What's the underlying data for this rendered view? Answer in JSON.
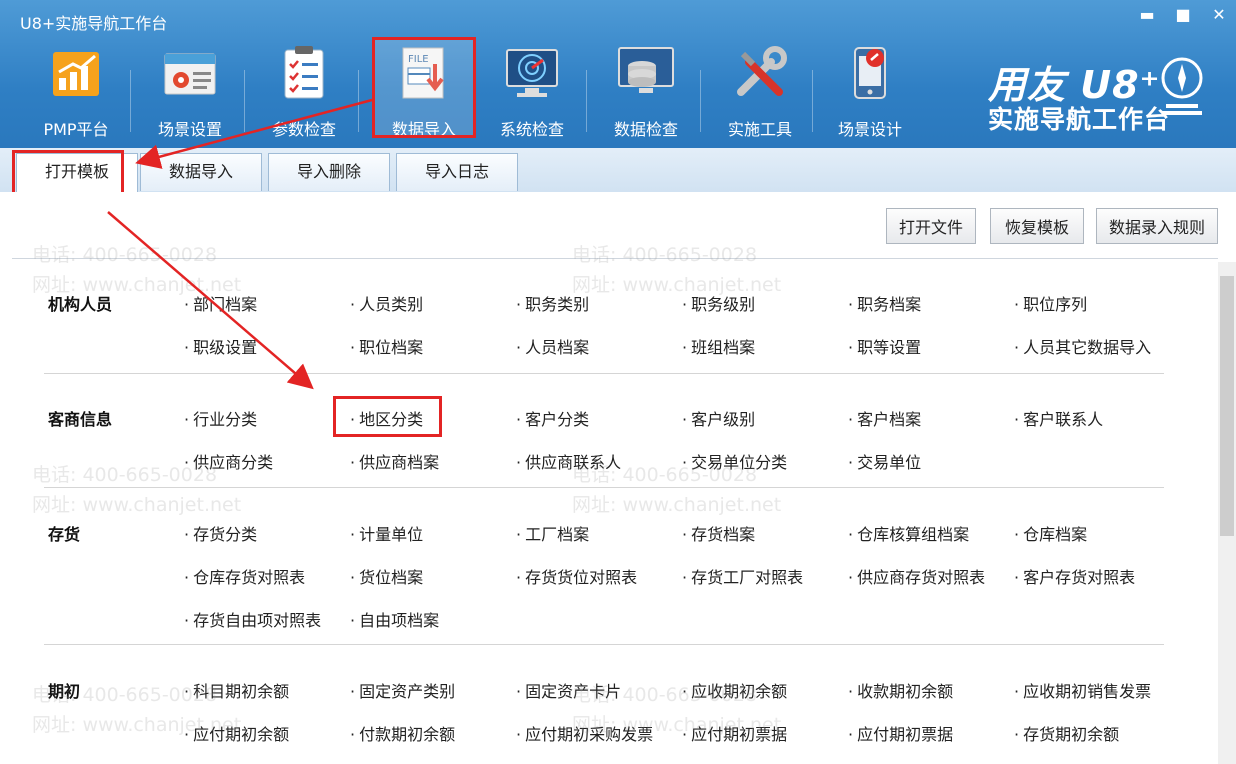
{
  "window": {
    "title": "U8+实施导航工作台",
    "min": "▬",
    "max": "■",
    "close": "✕"
  },
  "toolbar": [
    {
      "label": "PMP平台",
      "icon": "chart-bars-icon"
    },
    {
      "label": "场景设置",
      "icon": "gear-screen-icon"
    },
    {
      "label": "参数检查",
      "icon": "clipboard-check-icon"
    },
    {
      "label": "数据导入",
      "icon": "file-import-icon"
    },
    {
      "label": "系统检查",
      "icon": "monitor-radar-icon"
    },
    {
      "label": "数据检查",
      "icon": "database-check-icon"
    },
    {
      "label": "实施工具",
      "icon": "tools-icon"
    },
    {
      "label": "场景设计",
      "icon": "phone-design-icon"
    }
  ],
  "logo": {
    "line1": "用友 U8⁺",
    "line2": "实施导航工作台"
  },
  "tabs": [
    "打开模板",
    "数据导入",
    "导入删除",
    "导入日志"
  ],
  "buttons": {
    "open_file": "打开文件",
    "restore_template": "恢复模板",
    "entry_rules": "数据录入规则"
  },
  "sections": [
    {
      "title": "机构人员",
      "rows": [
        [
          "部门档案",
          "人员类别",
          "职务类别",
          "职务级别",
          "职务档案",
          "职位序列"
        ],
        [
          "职级设置",
          "职位档案",
          "人员档案",
          "班组档案",
          "职等设置",
          "人员其它数据导入"
        ]
      ]
    },
    {
      "title": "客商信息",
      "rows": [
        [
          "行业分类",
          "地区分类",
          "客户分类",
          "客户级别",
          "客户档案",
          "客户联系人"
        ],
        [
          "供应商分类",
          "供应商档案",
          "供应商联系人",
          "交易单位分类",
          "交易单位"
        ]
      ]
    },
    {
      "title": "存货",
      "rows": [
        [
          "存货分类",
          "计量单位",
          "工厂档案",
          "存货档案",
          "仓库核算组档案",
          "仓库档案"
        ],
        [
          "仓库存货对照表",
          "货位档案",
          "存货货位对照表",
          "存货工厂对照表",
          "供应商存货对照表",
          "客户存货对照表"
        ],
        [
          "存货自由项对照表",
          "自由项档案"
        ]
      ]
    },
    {
      "title": "期初",
      "rows": [
        [
          "科目期初余额",
          "固定资产类别",
          "固定资产卡片",
          "应收期初余额",
          "收款期初余额",
          "应收期初销售发票"
        ],
        [
          "应付期初余额",
          "付款期初余额",
          "应付期初采购发票",
          "应付期初票据",
          "应付期初票据",
          "存货期初余额"
        ]
      ]
    }
  ],
  "watermark": {
    "phone": "电话: 400-665-0028",
    "site": "网址: www.chanjet.net"
  },
  "colors": {
    "header": "#2f7fc4",
    "highlight": "#e32424"
  }
}
